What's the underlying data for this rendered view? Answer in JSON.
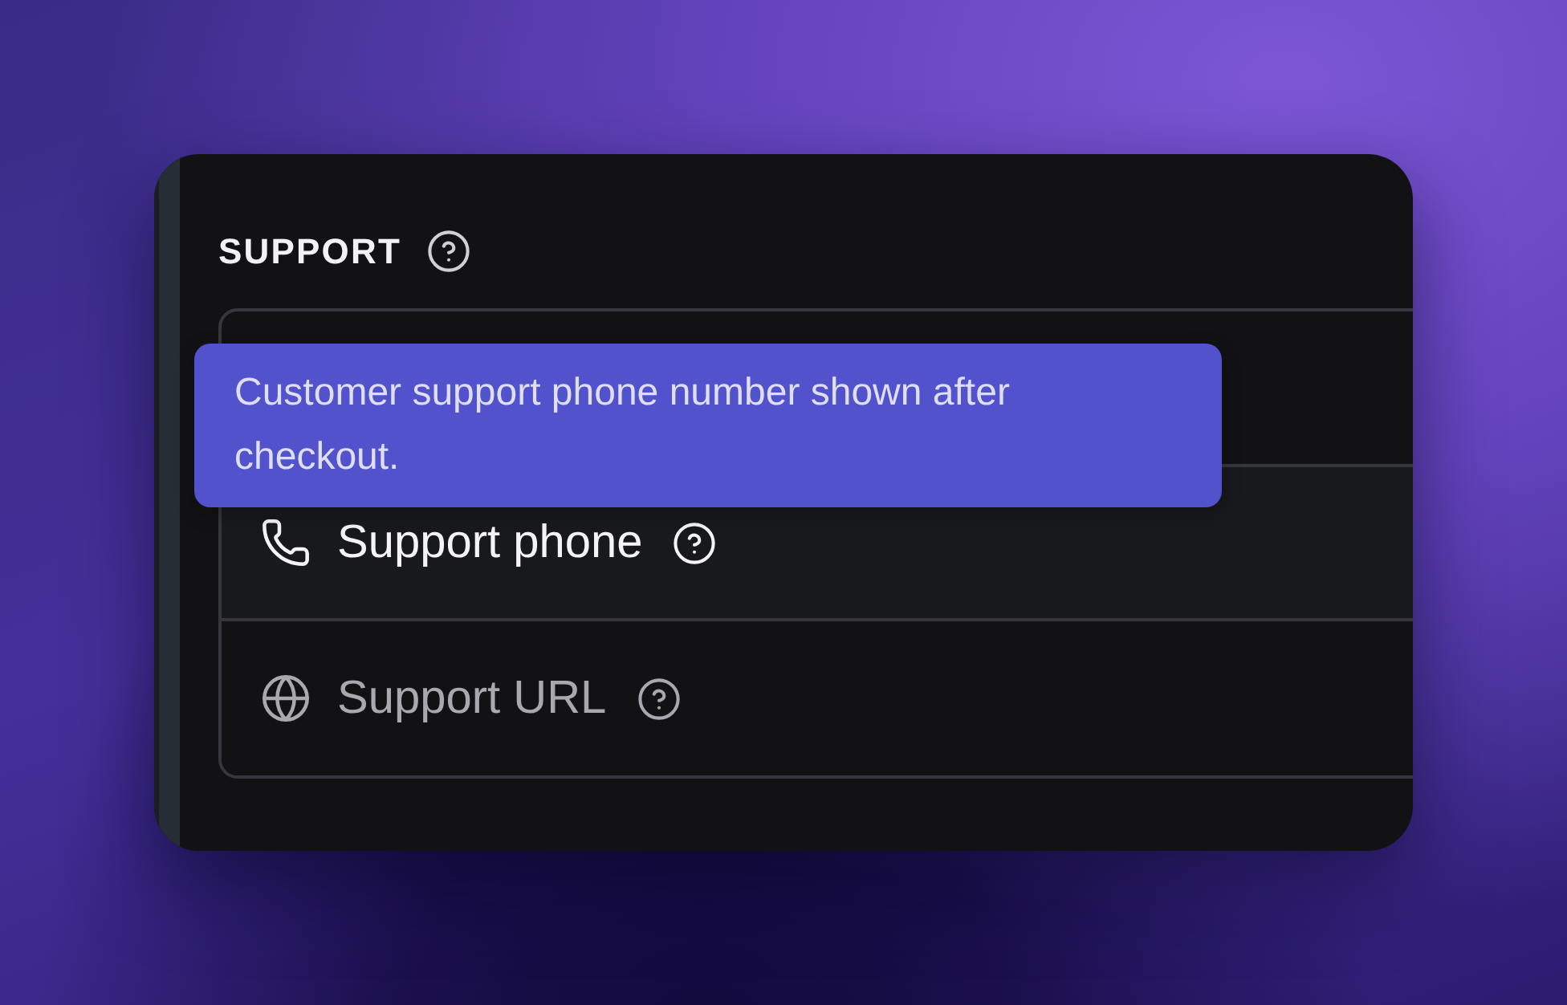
{
  "section": {
    "title": "SUPPORT"
  },
  "tooltip": {
    "text": "Customer support phone number shown after checkout."
  },
  "fields": [
    {
      "kind": "phone",
      "label": "Support phone",
      "selected": true
    },
    {
      "kind": "url",
      "label": "Support URL",
      "selected": false
    }
  ]
}
